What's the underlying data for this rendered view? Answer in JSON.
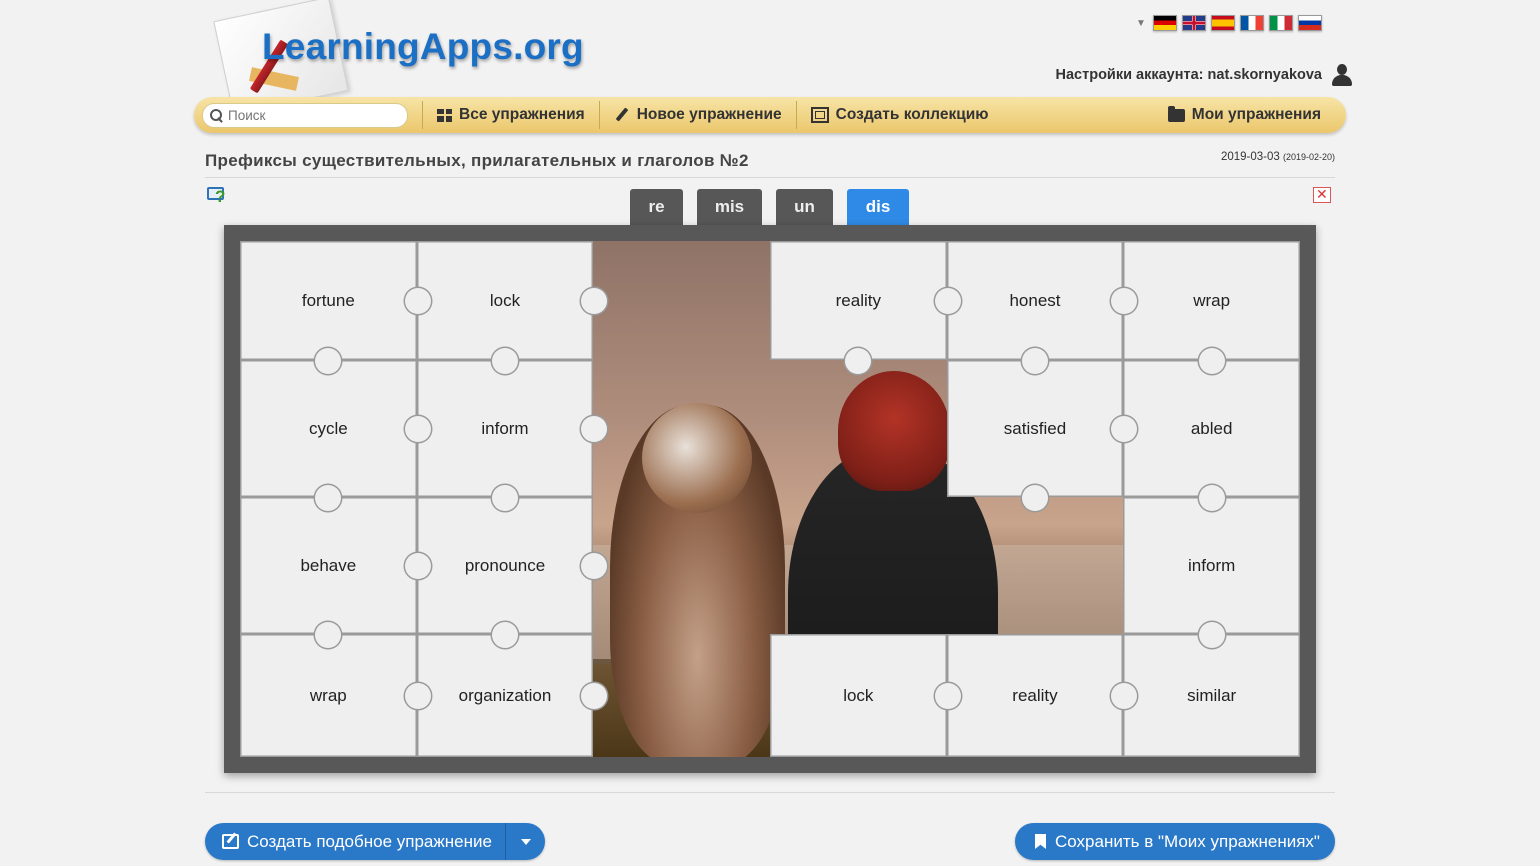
{
  "header": {
    "logo_text": "LearningApps.org",
    "account_label": "Настройки аккаунта:",
    "account_user": "nat.skornyakova",
    "languages": [
      "de",
      "en",
      "es",
      "fr",
      "it",
      "ru"
    ]
  },
  "nav": {
    "search_placeholder": "Поиск",
    "all_exercises": "Все упражнения",
    "new_exercise": "Новое упражнение",
    "create_collection": "Создать коллекцию",
    "my_exercises": "Мои упражнения"
  },
  "page": {
    "title": "Префиксы существительных, прилагательных и глаголов №2",
    "date": "2019-03-03",
    "date_created": "(2019-02-20)"
  },
  "prefix_tabs": [
    {
      "label": "re",
      "active": false
    },
    {
      "label": "mis",
      "active": false
    },
    {
      "label": "un",
      "active": false
    },
    {
      "label": "dis",
      "active": true
    }
  ],
  "puzzle": {
    "rows": 4,
    "cols": 6,
    "pieces": [
      {
        "row": 0,
        "col": 0,
        "word": "fortune"
      },
      {
        "row": 0,
        "col": 1,
        "word": "lock"
      },
      {
        "row": 0,
        "col": 3,
        "word": "reality"
      },
      {
        "row": 0,
        "col": 4,
        "word": "honest"
      },
      {
        "row": 0,
        "col": 5,
        "word": "wrap"
      },
      {
        "row": 1,
        "col": 0,
        "word": "cycle"
      },
      {
        "row": 1,
        "col": 1,
        "word": "inform"
      },
      {
        "row": 1,
        "col": 4,
        "word": "satisfied"
      },
      {
        "row": 1,
        "col": 5,
        "word": "abled"
      },
      {
        "row": 2,
        "col": 0,
        "word": "behave"
      },
      {
        "row": 2,
        "col": 1,
        "word": "pronounce"
      },
      {
        "row": 2,
        "col": 5,
        "word": "inform"
      },
      {
        "row": 3,
        "col": 0,
        "word": "wrap"
      },
      {
        "row": 3,
        "col": 1,
        "word": "organization"
      },
      {
        "row": 3,
        "col": 3,
        "word": "lock"
      },
      {
        "row": 3,
        "col": 4,
        "word": "reality"
      },
      {
        "row": 3,
        "col": 5,
        "word": "similar"
      }
    ]
  },
  "footer": {
    "create_similar": "Создать подобное упражнение",
    "save_to_mine": "Сохранить в \"Моих упражнениях\""
  }
}
